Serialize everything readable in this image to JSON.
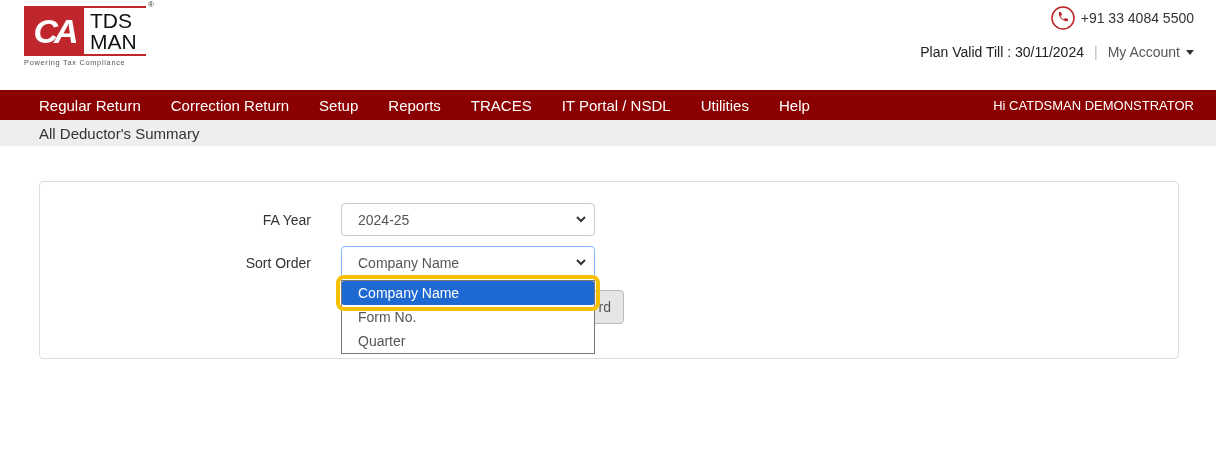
{
  "logo": {
    "mark": "CA",
    "line1": "TDS",
    "line2": "MAN",
    "registered": "®",
    "tagline": "Powering Tax Compliance"
  },
  "header": {
    "phone": "+91 33 4084 5500",
    "plan": "Plan Valid Till : 30/11/2024",
    "separator": "|",
    "account": "My Account"
  },
  "nav": {
    "items": [
      {
        "label": "Regular Return"
      },
      {
        "label": "Correction Return"
      },
      {
        "label": "Setup"
      },
      {
        "label": "Reports"
      },
      {
        "label": "TRACES"
      },
      {
        "label": "IT Portal / NSDL"
      },
      {
        "label": "Utilities"
      },
      {
        "label": "Help"
      }
    ],
    "greeting": "Hi CATDSMAN DEMONSTRATOR"
  },
  "breadcrumb": "All Deductor's Summary",
  "form": {
    "fa_year": {
      "label": "FA Year",
      "value": "2024-25"
    },
    "sort_order": {
      "label": "Sort Order",
      "value": "Company Name",
      "expanded": true,
      "options": [
        {
          "label": "Company Name",
          "selected": true
        },
        {
          "label": "Form No.",
          "selected": false
        },
        {
          "label": "Quarter",
          "selected": false
        }
      ]
    },
    "button": "rd"
  }
}
